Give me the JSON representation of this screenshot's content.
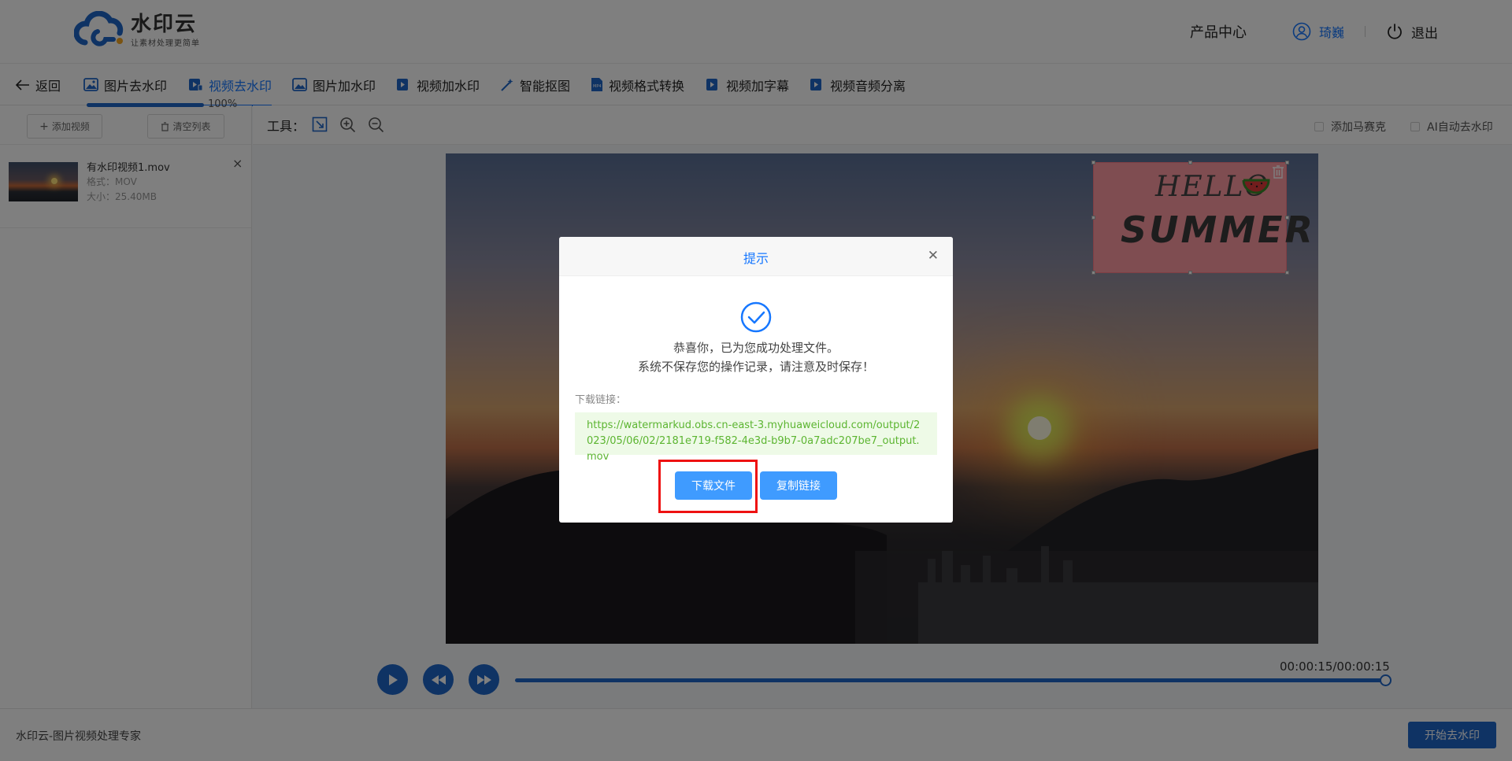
{
  "header": {
    "logo_title": "水印云",
    "logo_subtitle": "让素材处理更简单",
    "product_center": "产品中心",
    "username": "琦巍",
    "logout": "退出"
  },
  "nav": {
    "back": "返回",
    "tabs": [
      {
        "label": "图片去水印",
        "icon": "image-remove-icon"
      },
      {
        "label": "视频去水印",
        "icon": "video-remove-icon",
        "active": true
      },
      {
        "label": "图片加水印",
        "icon": "image-add-icon"
      },
      {
        "label": "视频加水印",
        "icon": "video-add-icon"
      },
      {
        "label": "智能抠图",
        "icon": "magic-wand-icon"
      },
      {
        "label": "视频格式转换",
        "icon": "format-convert-icon"
      },
      {
        "label": "视频加字幕",
        "icon": "subtitle-icon"
      },
      {
        "label": "视频音频分离",
        "icon": "audio-split-icon"
      }
    ]
  },
  "left_panel": {
    "add_video": "添加视频",
    "clear_list": "清空列表",
    "files": [
      {
        "name": "有水印视频1.mov",
        "format": "格式：MOV",
        "size": "大小：25.40MB",
        "progress_pct": 100,
        "progress_label": "100%"
      }
    ]
  },
  "toolbar": {
    "tools_label": "工具：",
    "mosaic_label": "添加马赛克",
    "ai_label": "AI自动去水印"
  },
  "watermark": {
    "line1": "HELLO",
    "line2": "SUMMER"
  },
  "player": {
    "time": "00:00:15/00:00:15",
    "progress_pct": 100
  },
  "footer": {
    "brand_text": "水印云-图片视频处理专家",
    "start_button": "开始去水印"
  },
  "dialog": {
    "title": "提示",
    "message1": "恭喜你，已为您成功处理文件。",
    "message2": "系统不保存您的操作记录，请注意及时保存！",
    "link_label": "下载链接：",
    "link_url": "https://watermarkud.obs.cn-east-3.myhuaweicloud.com/output/2023/05/06/02/2181e719-f582-4e3d-b9b7-0a7adc207be7_output.mov",
    "download_button": "下载文件",
    "copy_button": "复制链接"
  },
  "colors": {
    "accent": "#1677ff",
    "player_blue": "#1f66c9",
    "dialog_button": "#3f9bff",
    "link_green": "#5cb531",
    "highlight_red": "#ee1111"
  }
}
